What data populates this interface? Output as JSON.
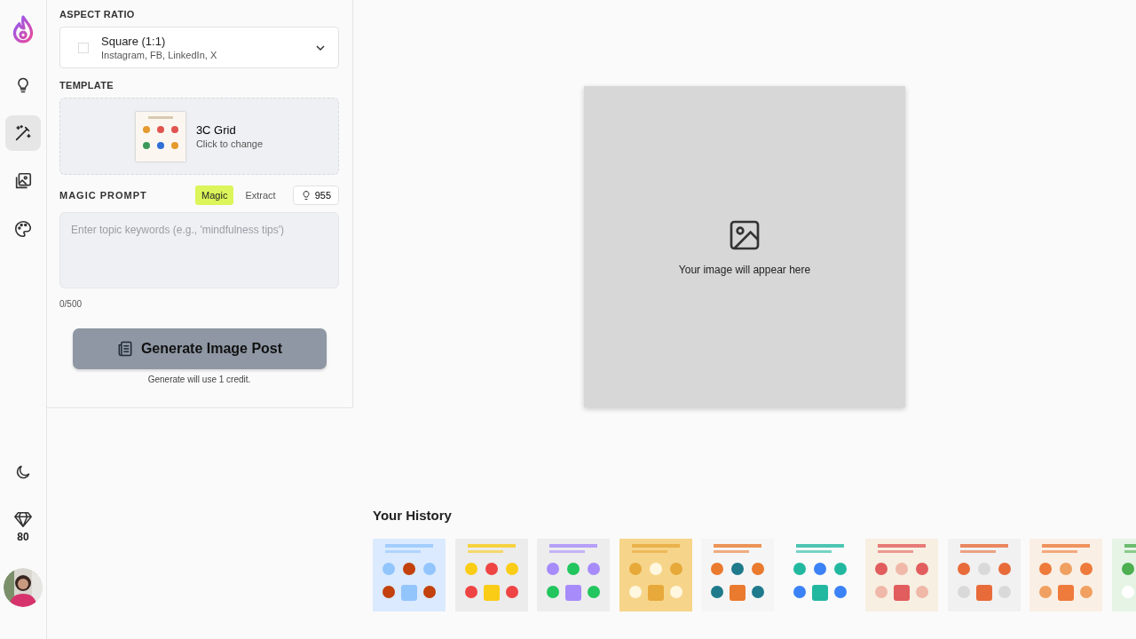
{
  "nav": {
    "items": [
      {
        "selected": false
      },
      {
        "selected": true
      },
      {
        "selected": false
      },
      {
        "selected": false
      }
    ],
    "credits": "80"
  },
  "aspect_ratio": {
    "label": "ASPECT RATIO",
    "value": "Square (1:1)",
    "detail": "Instagram, FB, LinkedIn, X"
  },
  "template": {
    "label": "TEMPLATE",
    "name": "3C Grid",
    "hint": "Click to change"
  },
  "magic_prompt": {
    "label": "MAGIC PROMPT",
    "modes": [
      {
        "label": "Magic",
        "selected": true
      },
      {
        "label": "Extract",
        "selected": false
      }
    ],
    "ideas": "955",
    "placeholder": "Enter topic keywords (e.g., 'mindfulness tips')",
    "counter": "0/500"
  },
  "generate": {
    "label": "Generate Image Post",
    "note": "Generate will use 1 credit."
  },
  "preview": {
    "message": "Your image will appear here"
  },
  "history": {
    "title": "Your History"
  }
}
